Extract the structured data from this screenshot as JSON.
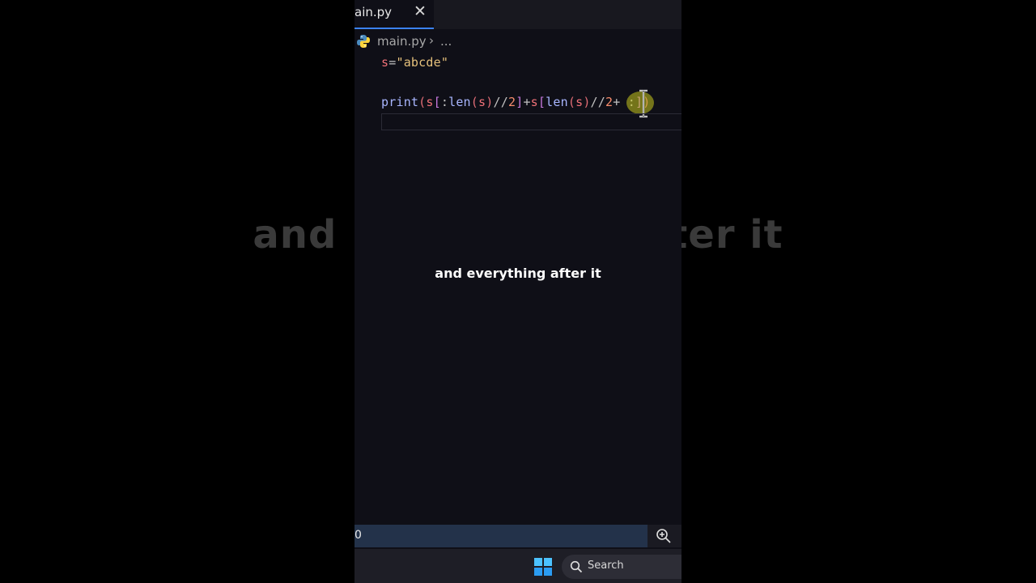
{
  "background_caption": {
    "left": "and",
    "right": "ter it"
  },
  "editor": {
    "tab": {
      "label": "ain.py",
      "close_icon": "close-icon"
    },
    "breadcrumb": {
      "file": "main.py",
      "separator": "›",
      "more": "..."
    },
    "code_lines": {
      "line1": {
        "var": "s",
        "op": "=",
        "str": "\"abcde\""
      },
      "line2": {
        "fn": "print",
        "p1": "(",
        "s1": "s",
        "b1": "[",
        "colon1": ":",
        "len1": "len",
        "p2": "(",
        "s2": "s",
        "p3": ")",
        "div1": "//",
        "two1": "2",
        "b2": "]",
        "plus": "+",
        "s3": "s",
        "b3": "[",
        "len2": "len",
        "p4": "(",
        "s4": "s",
        "p5": ")",
        "div2": "//",
        "two2": "2",
        "plus2": "+",
        "sp": " ",
        "colon2": ":",
        "b4": "]",
        "p6": ")"
      }
    }
  },
  "subtitle": "and everything after it",
  "statusbar": {
    "text": "0",
    "zoom_icon": "zoom-in-icon"
  },
  "taskbar": {
    "search_label": "Search",
    "windows_icon": "windows-logo-icon"
  },
  "colors": {
    "editor_bg": "#0f0f17",
    "tab_accent": "#3b82f6",
    "statusbar_bg": "#23324a",
    "highlight": "#c8c81e"
  }
}
